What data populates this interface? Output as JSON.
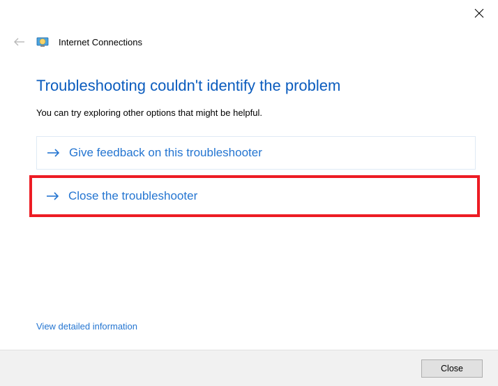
{
  "window": {
    "title": "Internet Connections"
  },
  "main": {
    "heading": "Troubleshooting couldn't identify the problem",
    "subtext": "You can try exploring other options that might be helpful."
  },
  "options": {
    "feedback": "Give feedback on this troubleshooter",
    "close": "Close the troubleshooter"
  },
  "links": {
    "details": "View detailed information"
  },
  "footer": {
    "close_button": "Close"
  },
  "colors": {
    "link_blue": "#2475d1",
    "heading_blue": "#0b5cbe",
    "highlight_red": "#ed1c24"
  }
}
